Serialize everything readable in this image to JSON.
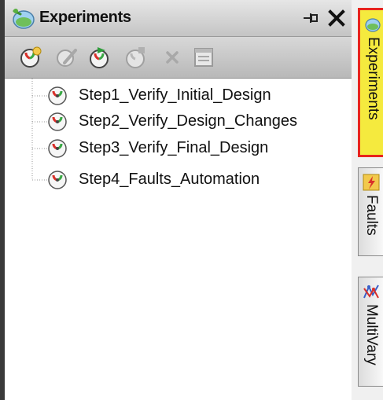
{
  "panel": {
    "title": "Experiments",
    "title_icon": "experiments-flask-icon",
    "pin_icon": "pin-icon",
    "close_icon": "close-icon"
  },
  "toolbar": {
    "buttons": [
      {
        "icon": "new-experiment-icon",
        "enabled": true
      },
      {
        "icon": "edit-experiment-icon",
        "enabled": false
      },
      {
        "icon": "run-experiment-icon",
        "enabled": true
      },
      {
        "icon": "stop-experiment-icon",
        "enabled": false
      },
      {
        "icon": "delete-icon",
        "enabled": false
      },
      {
        "icon": "properties-icon",
        "enabled": false
      }
    ]
  },
  "tree": {
    "items": [
      {
        "label": "Step1_Verify_Initial_Design",
        "icon": "experiment-gauge-icon"
      },
      {
        "label": "Step2_Verify_Design_Changes",
        "icon": "experiment-gauge-icon"
      },
      {
        "label": "Step3_Verify_Final_Design",
        "icon": "experiment-gauge-icon"
      },
      {
        "label": "Step4_Faults_Automation",
        "icon": "experiment-gauge-icon"
      }
    ]
  },
  "side_tabs": [
    {
      "label": "Experiments",
      "icon": "experiments-flask-icon",
      "active": true
    },
    {
      "label": "Faults",
      "icon": "faults-lightning-icon",
      "active": false
    },
    {
      "label": "MultiVary",
      "icon": "multivary-icon",
      "active": false
    }
  ],
  "colors": {
    "active_tab_bg": "#f5ea3e",
    "active_tab_border": "#e8241c",
    "gauge_red": "#d9302a",
    "gauge_green": "#3aa845"
  }
}
